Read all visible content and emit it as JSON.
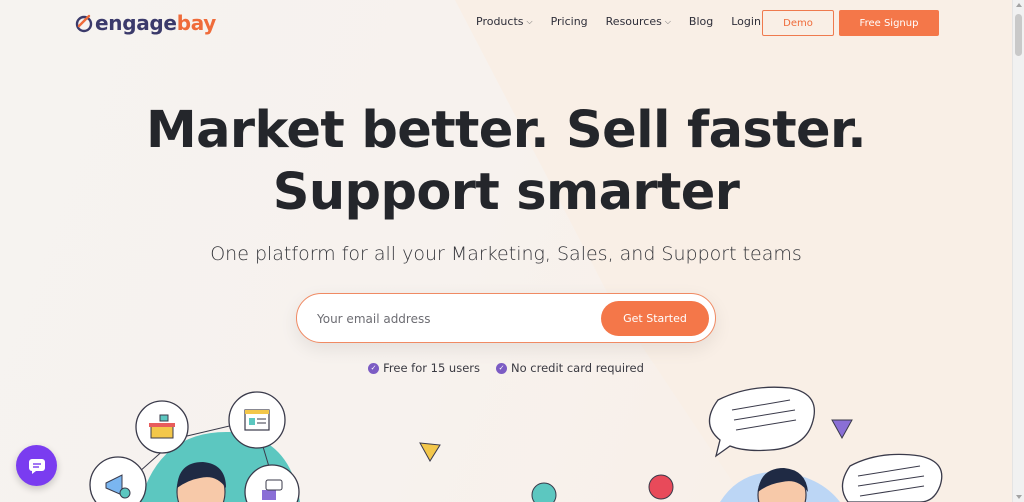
{
  "header": {
    "logo_text_a": "engage",
    "logo_text_b": "bay",
    "nav": [
      {
        "label": "Products",
        "has_dropdown": true
      },
      {
        "label": "Pricing",
        "has_dropdown": false
      },
      {
        "label": "Resources",
        "has_dropdown": true
      },
      {
        "label": "Blog",
        "has_dropdown": false
      },
      {
        "label": "Login",
        "has_dropdown": false
      }
    ],
    "demo_label": "Demo",
    "signup_label": "Free Signup"
  },
  "hero": {
    "title_line1": "Market better. Sell faster.",
    "title_line2": "Support smarter",
    "subtitle": "One platform for all your Marketing, Sales, and Support teams",
    "email_placeholder": "Your email address",
    "cta_label": "Get Started",
    "perks": [
      "Free for 15 users",
      "No credit card required"
    ]
  },
  "colors": {
    "accent": "#f47749",
    "brand_dark": "#3b3a6b",
    "check": "#7c5cc4",
    "chat_fab": "#7a3cf0"
  },
  "icons": {
    "chevron": "chevron-down-icon",
    "check": "check-circle-icon",
    "chat": "chat-icon"
  }
}
